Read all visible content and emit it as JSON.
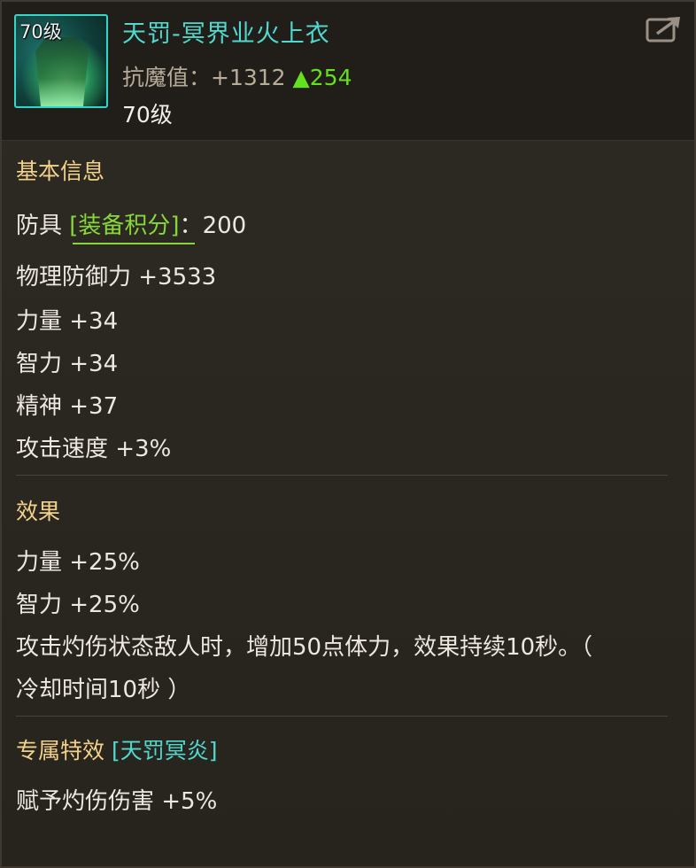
{
  "item": {
    "icon_level": "70级",
    "name": "天罚-冥界业火上衣",
    "stat_label": "抗魔值：+1312",
    "stat_delta": "▲254",
    "level": "70级"
  },
  "basic": {
    "title": "基本信息",
    "armor_prefix": "防具",
    "score_label": "[装备积分]",
    "score_value": "：200",
    "rows": [
      "物理防御力 +3533",
      "力量 +34",
      "智力 +34",
      "精神 +37",
      "攻击速度 +3%"
    ]
  },
  "effect": {
    "title": "效果",
    "rows": [
      "力量 +25%",
      "智力 +25%",
      "攻击灼伤状态敌人时，增加50点体力，效果持续10秒。（",
      "冷却时间10秒 ）"
    ]
  },
  "exclusive": {
    "title": "专属特效",
    "tag": "[天罚冥炎]",
    "rows": [
      "赋予灼伤伤害 +5%"
    ]
  },
  "colors": {
    "item_name": "#4fd9cf",
    "section_title": "#f2d28a",
    "delta": "#63e01e",
    "score_tag": "#86d73b",
    "text": "#ece7df"
  },
  "icons": [
    "armor-item-icon",
    "export-share-icon"
  ]
}
